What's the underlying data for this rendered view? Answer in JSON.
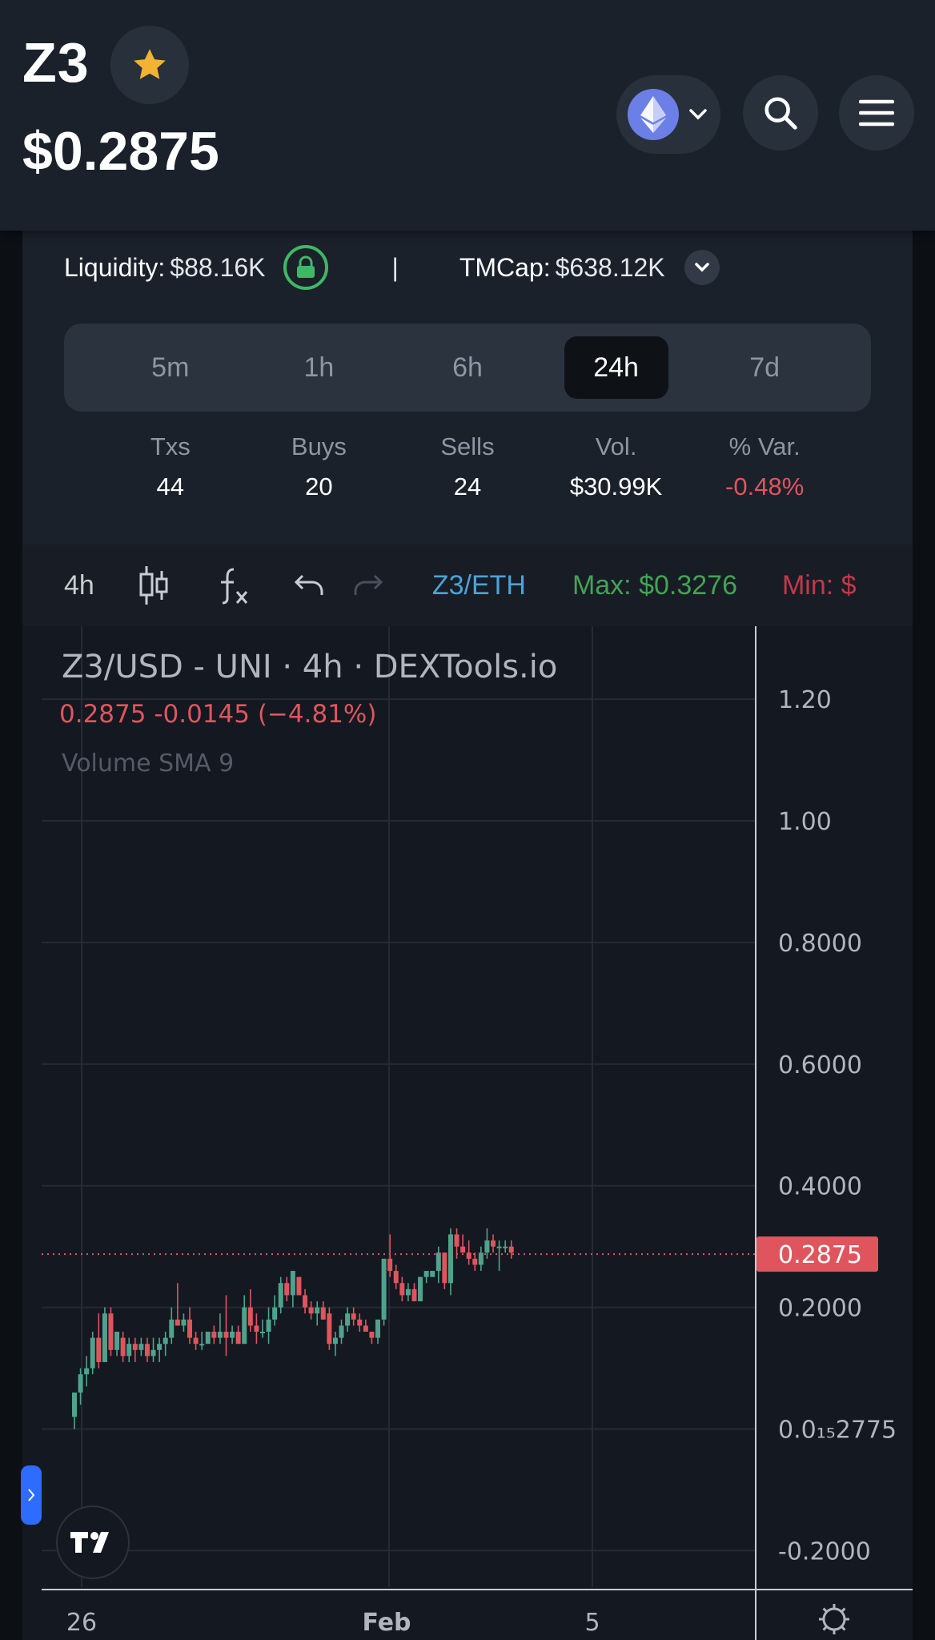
{
  "header": {
    "symbol": "Z3",
    "price": "$0.2875",
    "icons": {
      "favorite": "star-icon",
      "chain": "ethereum-icon",
      "search": "search-icon",
      "menu": "menu-icon"
    },
    "accent": "#f2b335"
  },
  "stats": {
    "liquidity_label": "Liquidity:",
    "liquidity_value": "$88.16K",
    "separator": "|",
    "tmcap_label": "TMCap:",
    "tmcap_value": "$638.12K",
    "timeframes": [
      "5m",
      "1h",
      "6h",
      "24h",
      "7d"
    ],
    "active_timeframe": "24h",
    "columns": [
      {
        "label": "Txs",
        "value": "44"
      },
      {
        "label": "Buys",
        "value": "20"
      },
      {
        "label": "Sells",
        "value": "24"
      },
      {
        "label": "Vol.",
        "value": "$30.99K"
      },
      {
        "label": "% Var.",
        "value": "-0.48%"
      }
    ]
  },
  "toolbar": {
    "interval": "4h",
    "pair": "Z3/ETH",
    "max": "Max: $0.3276",
    "min": "Min: $"
  },
  "chart": {
    "legend_title": "Z3/USD - UNI · 4h · DEXTools.io",
    "legend_values": "0.2875  -0.0145 (−4.81%)",
    "volume_label": "Volume SMA 9",
    "y_ticks": [
      "1.20",
      "1.00",
      "0.8000",
      "0.6000",
      "0.4000",
      "0.2000",
      "0.0₁₅2775",
      "-0.2000"
    ],
    "x_ticks": [
      "26",
      "Feb",
      "5"
    ],
    "current_price_label": "0.2875",
    "colors": {
      "up": "#4fa38d",
      "down": "#e0555d",
      "background": "#141821"
    }
  },
  "chart_data": {
    "type": "candlestick",
    "title": "Z3/USD - UNI · 4h · DEXTools.io",
    "ylim": [
      -0.26,
      1.32
    ],
    "last_price": 0.2875,
    "candles": [
      [
        0.02,
        0.06,
        0.0,
        0.06
      ],
      [
        0.06,
        0.1,
        0.04,
        0.09
      ],
      [
        0.09,
        0.12,
        0.07,
        0.1
      ],
      [
        0.1,
        0.16,
        0.09,
        0.15
      ],
      [
        0.15,
        0.19,
        0.1,
        0.11
      ],
      [
        0.11,
        0.2,
        0.11,
        0.19
      ],
      [
        0.19,
        0.2,
        0.12,
        0.13
      ],
      [
        0.13,
        0.16,
        0.12,
        0.16
      ],
      [
        0.15,
        0.16,
        0.11,
        0.12
      ],
      [
        0.12,
        0.15,
        0.11,
        0.14
      ],
      [
        0.14,
        0.15,
        0.11,
        0.13
      ],
      [
        0.13,
        0.15,
        0.12,
        0.14
      ],
      [
        0.14,
        0.15,
        0.11,
        0.12
      ],
      [
        0.12,
        0.15,
        0.11,
        0.13
      ],
      [
        0.13,
        0.15,
        0.11,
        0.14
      ],
      [
        0.14,
        0.16,
        0.12,
        0.15
      ],
      [
        0.15,
        0.2,
        0.14,
        0.18
      ],
      [
        0.18,
        0.24,
        0.17,
        0.17
      ],
      [
        0.17,
        0.19,
        0.16,
        0.18
      ],
      [
        0.18,
        0.2,
        0.14,
        0.15
      ],
      [
        0.15,
        0.16,
        0.13,
        0.14
      ],
      [
        0.14,
        0.16,
        0.13,
        0.14
      ],
      [
        0.14,
        0.16,
        0.14,
        0.16
      ],
      [
        0.16,
        0.17,
        0.14,
        0.15
      ],
      [
        0.15,
        0.19,
        0.14,
        0.16
      ],
      [
        0.16,
        0.22,
        0.12,
        0.15
      ],
      [
        0.15,
        0.17,
        0.14,
        0.16
      ],
      [
        0.16,
        0.17,
        0.14,
        0.14
      ],
      [
        0.14,
        0.22,
        0.14,
        0.2
      ],
      [
        0.2,
        0.23,
        0.16,
        0.17
      ],
      [
        0.17,
        0.19,
        0.14,
        0.16
      ],
      [
        0.16,
        0.18,
        0.15,
        0.16
      ],
      [
        0.16,
        0.2,
        0.14,
        0.18
      ],
      [
        0.18,
        0.22,
        0.17,
        0.2
      ],
      [
        0.2,
        0.25,
        0.19,
        0.24
      ],
      [
        0.24,
        0.25,
        0.21,
        0.22
      ],
      [
        0.22,
        0.26,
        0.2,
        0.26
      ],
      [
        0.25,
        0.25,
        0.22,
        0.22
      ],
      [
        0.22,
        0.23,
        0.19,
        0.2
      ],
      [
        0.2,
        0.21,
        0.18,
        0.19
      ],
      [
        0.19,
        0.21,
        0.17,
        0.2
      ],
      [
        0.2,
        0.21,
        0.18,
        0.18
      ],
      [
        0.19,
        0.2,
        0.13,
        0.14
      ],
      [
        0.14,
        0.16,
        0.12,
        0.15
      ],
      [
        0.15,
        0.18,
        0.14,
        0.17
      ],
      [
        0.17,
        0.2,
        0.16,
        0.19
      ],
      [
        0.19,
        0.2,
        0.17,
        0.18
      ],
      [
        0.18,
        0.19,
        0.16,
        0.17
      ],
      [
        0.17,
        0.18,
        0.16,
        0.16
      ],
      [
        0.16,
        0.16,
        0.14,
        0.15
      ],
      [
        0.15,
        0.18,
        0.14,
        0.18
      ],
      [
        0.18,
        0.28,
        0.17,
        0.28
      ],
      [
        0.28,
        0.32,
        0.25,
        0.26
      ],
      [
        0.26,
        0.27,
        0.23,
        0.24
      ],
      [
        0.24,
        0.25,
        0.21,
        0.22
      ],
      [
        0.22,
        0.24,
        0.21,
        0.23
      ],
      [
        0.23,
        0.24,
        0.21,
        0.21
      ],
      [
        0.21,
        0.25,
        0.21,
        0.25
      ],
      [
        0.25,
        0.26,
        0.24,
        0.26
      ],
      [
        0.25,
        0.26,
        0.25,
        0.26
      ],
      [
        0.26,
        0.3,
        0.24,
        0.29
      ],
      [
        0.29,
        0.29,
        0.23,
        0.24
      ],
      [
        0.24,
        0.33,
        0.22,
        0.32
      ],
      [
        0.32,
        0.33,
        0.28,
        0.3
      ],
      [
        0.3,
        0.32,
        0.29,
        0.29
      ],
      [
        0.29,
        0.31,
        0.27,
        0.28
      ],
      [
        0.28,
        0.29,
        0.26,
        0.27
      ],
      [
        0.27,
        0.3,
        0.26,
        0.29
      ],
      [
        0.29,
        0.33,
        0.28,
        0.31
      ],
      [
        0.31,
        0.32,
        0.29,
        0.3
      ],
      [
        0.3,
        0.31,
        0.26,
        0.3
      ],
      [
        0.3,
        0.31,
        0.29,
        0.3
      ],
      [
        0.3,
        0.31,
        0.28,
        0.29
      ]
    ]
  }
}
